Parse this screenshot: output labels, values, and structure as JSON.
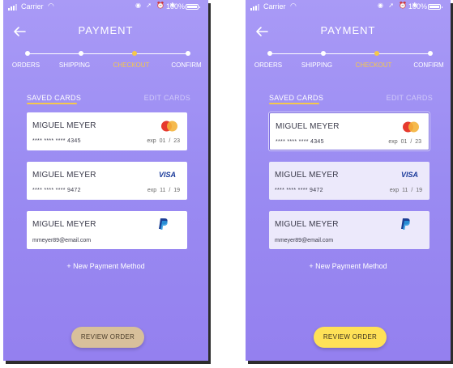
{
  "screens": [
    {
      "status": {
        "carrier": "Carrier",
        "battery": "100%"
      },
      "header": {
        "title": "PAYMENT"
      },
      "steps": [
        "ORDERS",
        "SHIPPING",
        "CHECKOUT",
        "CONFIRM"
      ],
      "active_step": "CHECKOUT",
      "tabs": {
        "saved": "SAVED CARDS",
        "edit": "EDIT CARDS"
      },
      "cards": [
        {
          "name": "MIGUEL MEYER",
          "number": "**** **** **** 4345",
          "exp": "exp  01 / 23",
          "brand": "mastercard-icon"
        },
        {
          "name": "MIGUEL MEYER",
          "number": "**** **** **** 9472",
          "exp": "exp  11 / 19",
          "brand": "VISA"
        },
        {
          "name": "MIGUEL MEYER",
          "email": "mmeyer89@email.com",
          "brand": "paypal-icon"
        }
      ],
      "add_method": "+ New Payment Method",
      "review_button": "REVIEW ORDER"
    },
    {
      "status": {
        "carrier": "Carrier",
        "battery": "100%"
      },
      "header": {
        "title": "PAYMENT"
      },
      "steps": [
        "ORDERS",
        "SHIPPING",
        "CHECKOUT",
        "CONFIRM"
      ],
      "active_step": "CHECKOUT",
      "tabs": {
        "saved": "SAVED CARDS",
        "edit": "EDIT CARDS"
      },
      "cards": [
        {
          "name": "MIGUEL MEYER",
          "number": "**** **** **** 4345",
          "exp": "exp  01 / 23",
          "brand": "mastercard-icon",
          "selected": true
        },
        {
          "name": "MIGUEL MEYER",
          "number": "**** **** **** 9472",
          "exp": "exp  11 / 19",
          "brand": "VISA"
        },
        {
          "name": "MIGUEL MEYER",
          "email": "mmeyer89@email.com",
          "brand": "paypal-icon"
        }
      ],
      "add_method": "+ New Payment Method",
      "review_button": "REVIEW ORDER"
    }
  ],
  "colors": {
    "accent": "#f5c84a",
    "background": "#9a8bf2",
    "review_disabled": "#d8c09b",
    "review_enabled": "#ffe157"
  }
}
